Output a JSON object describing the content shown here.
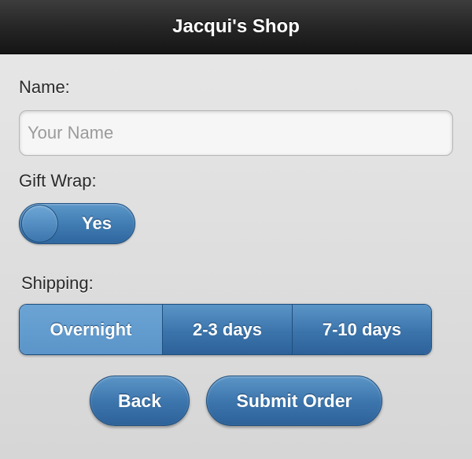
{
  "header": {
    "title": "Jacqui's Shop"
  },
  "form": {
    "name_label": "Name:",
    "name_placeholder": "Your Name",
    "name_value": "",
    "gift_wrap_label": "Gift Wrap:",
    "gift_wrap_value": "Yes",
    "shipping_label": "Shipping:",
    "shipping_options": [
      {
        "label": "Overnight",
        "selected": true
      },
      {
        "label": "2-3 days",
        "selected": false
      },
      {
        "label": "7-10 days",
        "selected": false
      }
    ]
  },
  "actions": {
    "back_label": "Back",
    "submit_label": "Submit Order"
  },
  "colors": {
    "header_bg": "#262626",
    "page_bg": "#dcdcdc",
    "accent_blue": "#3b74ab",
    "accent_blue_active": "#5b95c9"
  }
}
